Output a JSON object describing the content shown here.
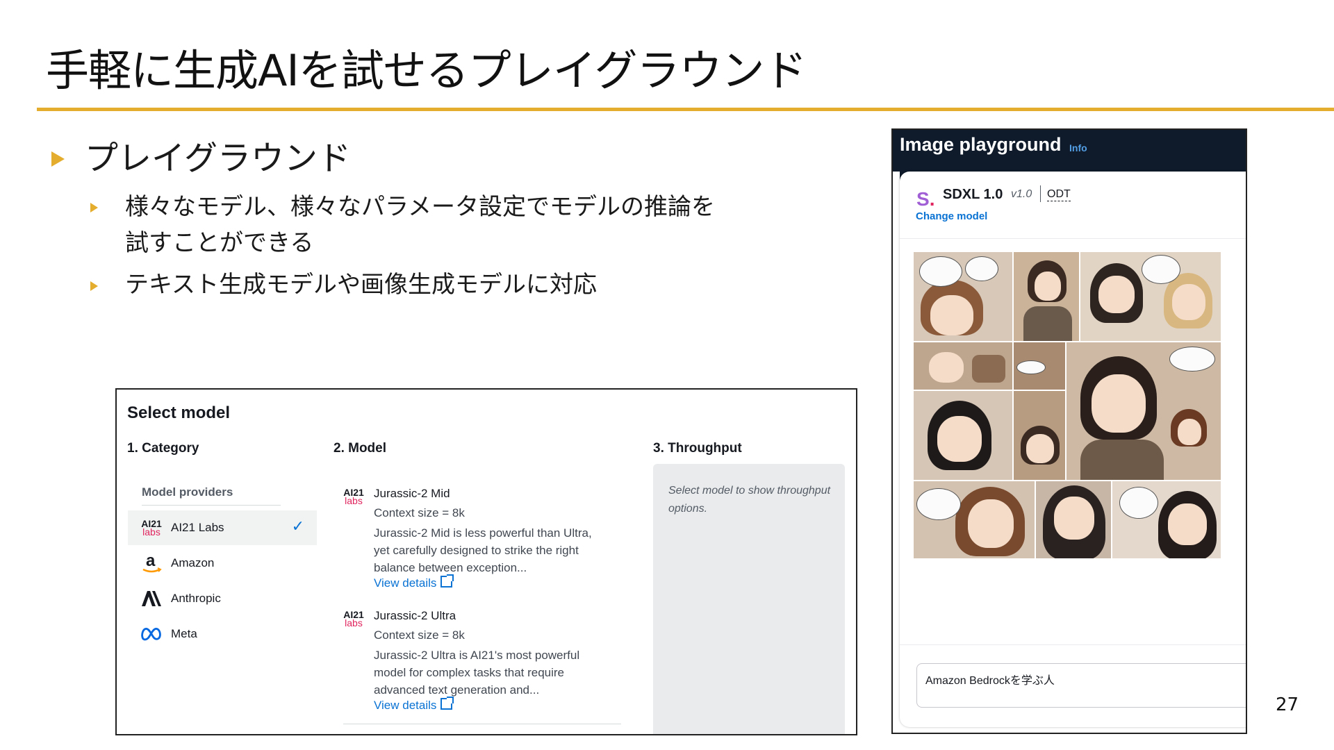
{
  "slide": {
    "title": "手軽に生成AIを試せるプレイグラウンド",
    "page_number": "27",
    "bullet_main": "プレイグラウンド",
    "bullet_sub1_line1": "様々なモデル、様々なパラメータ設定でモデルの推論を",
    "bullet_sub1_line2": "試すことができる",
    "bullet_sub2": "テキスト生成モデルや画像生成モデルに対応",
    "accent_color": "#e5ad2d"
  },
  "select_model": {
    "heading": "Select model",
    "col_category": "1. Category",
    "col_model": "2. Model",
    "col_throughput": "3. Throughput",
    "providers_label": "Model providers",
    "providers": [
      {
        "label": "AI21 Labs",
        "icon": "ai21-labs-logo",
        "selected": true
      },
      {
        "label": "Amazon",
        "icon": "amazon-logo",
        "selected": false
      },
      {
        "label": "Anthropic",
        "icon": "anthropic-logo",
        "selected": false
      },
      {
        "label": "Meta",
        "icon": "meta-logo",
        "selected": false
      }
    ],
    "ai21_logo_top": "AI21",
    "ai21_logo_bottom": "labs",
    "models": [
      {
        "name": "Jurassic-2 Mid",
        "context": "Context size = 8k",
        "description": "Jurassic-2 Mid is less powerful than Ultra, yet carefully designed to strike the right balance between exception...",
        "link": "View details"
      },
      {
        "name": "Jurassic-2 Ultra",
        "context": "Context size = 8k",
        "description": "Jurassic-2 Ultra is AI21's most powerful model for complex tasks that require advanced text generation and...",
        "link": "View details"
      }
    ],
    "throughput_hint": "Select model to show throughput options.",
    "link_color": "#0972d3"
  },
  "image_playground": {
    "title": "Image playground",
    "info_label": "Info",
    "model_logo": "S",
    "model_name": "SDXL 1.0",
    "model_version": "v1.0",
    "model_badge": "ODT",
    "change_model": "Change model",
    "prompt": "Amazon Bedrockを学ぶ人",
    "header_color": "#0f1b2a"
  }
}
